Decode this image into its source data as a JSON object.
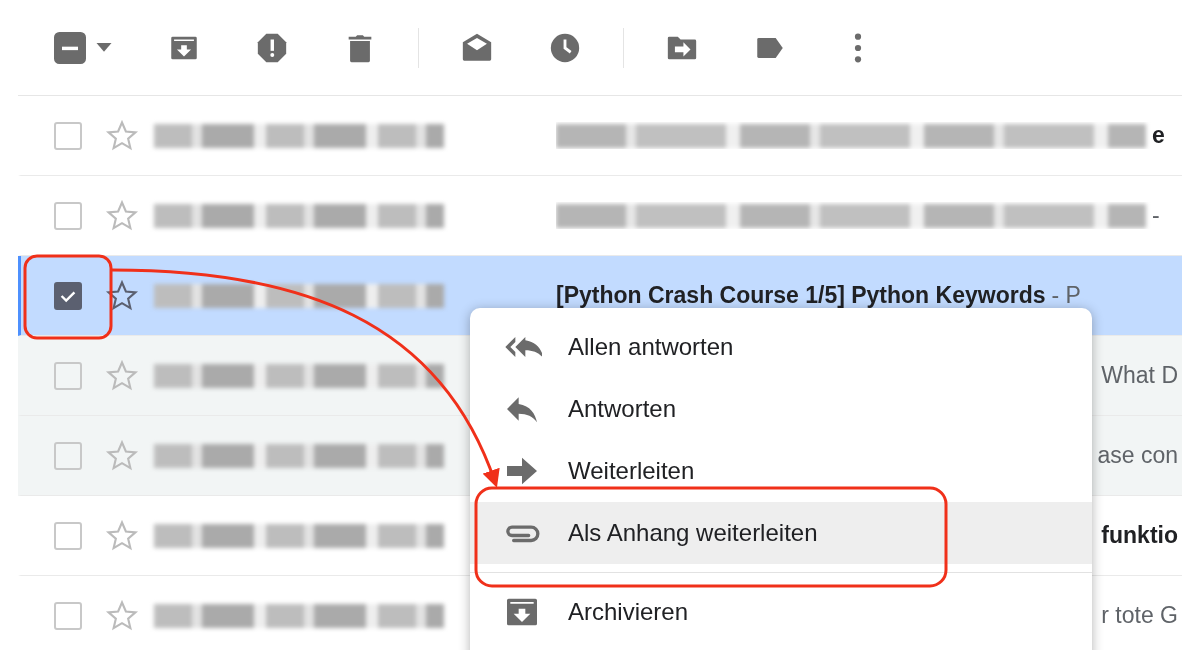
{
  "toolbar": {
    "partially_selected": true
  },
  "rows": [
    {
      "checked": false,
      "starred": false,
      "read": false,
      "subject": "e",
      "snippet": ""
    },
    {
      "checked": false,
      "starred": false,
      "read": false,
      "subject": "",
      "snippet": "-"
    },
    {
      "checked": true,
      "starred": false,
      "read": false,
      "subject": "[Python Crash Course 1/5] Python Keywords",
      "snippet": "- P"
    },
    {
      "checked": false,
      "starred": false,
      "read": true,
      "subject": "",
      "snippet": "What D"
    },
    {
      "checked": false,
      "starred": false,
      "read": true,
      "subject": "",
      "snippet": "ase con"
    },
    {
      "checked": false,
      "starred": false,
      "read": false,
      "subject": "funktio",
      "snippet": ""
    },
    {
      "checked": false,
      "starred": false,
      "read": false,
      "subject": "",
      "snippet": "r tote G"
    }
  ],
  "context_menu": {
    "items": [
      {
        "kind": "reply-all",
        "label": "Allen antworten",
        "highlighted": false
      },
      {
        "kind": "reply",
        "label": "Antworten",
        "highlighted": false
      },
      {
        "kind": "forward",
        "label": "Weiterleiten",
        "highlighted": false
      },
      {
        "kind": "attach",
        "label": "Als Anhang weiterleiten",
        "highlighted": true
      },
      {
        "kind": "divider"
      },
      {
        "kind": "archive",
        "label": "Archivieren",
        "highlighted": false
      }
    ]
  }
}
